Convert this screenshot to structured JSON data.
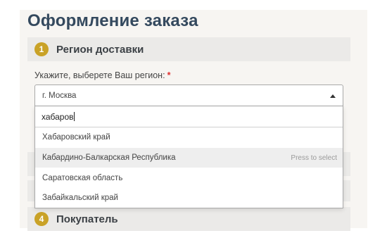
{
  "page": {
    "title": "Оформление заказа"
  },
  "steps": [
    {
      "number": "1",
      "title": "Регион доставки"
    },
    {
      "number": "4",
      "title": "Покупатель"
    }
  ],
  "region": {
    "label": "Укажите, выберете Ваш регион:",
    "required_mark": "*",
    "selected_value": "г. Москва",
    "search_value": "хабаров",
    "options": [
      {
        "label": "Хабаровский край",
        "highlighted": false
      },
      {
        "label": "Кабардино-Балкарская Республика",
        "highlighted": true,
        "hint": "Press to select"
      },
      {
        "label": "Саратовская область",
        "highlighted": false
      },
      {
        "label": "Забайкальский край",
        "highlighted": false
      }
    ]
  },
  "colors": {
    "step_badge": "#c9a227",
    "title": "#34495e",
    "required": "#e03030"
  }
}
